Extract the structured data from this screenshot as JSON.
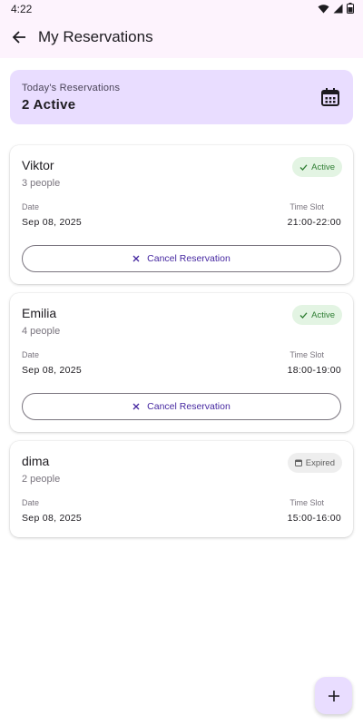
{
  "status_bar": {
    "time": "4:22"
  },
  "app_bar": {
    "title": "My Reservations"
  },
  "summary": {
    "label": "Today's Reservations",
    "value": "2 Active"
  },
  "reservations": [
    {
      "name": "Viktor",
      "people": "3 people",
      "status": "Active",
      "date_label": "Date",
      "date": "Sep 08, 2025",
      "slot_label": "Time Slot",
      "slot": "21:00-22:00",
      "action": "Cancel Reservation"
    },
    {
      "name": "Emilia",
      "people": "4 people",
      "status": "Active",
      "date_label": "Date",
      "date": "Sep 08, 2025",
      "slot_label": "Time Slot",
      "slot": "18:00-19:00",
      "action": "Cancel Reservation"
    },
    {
      "name": "dima",
      "people": "2 people",
      "status": "Expired",
      "date_label": "Date",
      "date": "Sep 08, 2025",
      "slot_label": "Time Slot",
      "slot": "15:00-16:00"
    }
  ],
  "colors": {
    "accent": "#e9ddff",
    "active": "#2e7d32",
    "action_text": "#4527a0"
  },
  "icons": [
    "back-arrow-icon",
    "calendar-icon",
    "check-icon",
    "close-icon",
    "calendar-small-icon",
    "plus-icon",
    "wifi-icon",
    "battery-icon"
  ]
}
